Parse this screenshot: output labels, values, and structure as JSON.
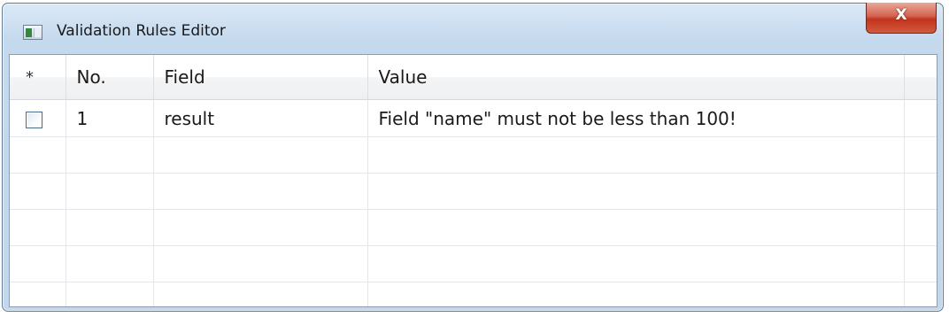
{
  "window": {
    "title": "Validation Rules Editor",
    "close_glyph": "X",
    "icon": "form-window-icon"
  },
  "grid": {
    "columns": [
      {
        "label": "*"
      },
      {
        "label": "No."
      },
      {
        "label": "Field"
      },
      {
        "label": "Value"
      },
      {
        "label": ""
      }
    ],
    "rows": [
      {
        "checked": false,
        "no": "1",
        "field": "result",
        "value": "Field \"name\" must not be less than 100!"
      }
    ],
    "empty_rows": 5
  },
  "colors": {
    "titlebar": "#c5d9ee",
    "close_button": "#c2341e",
    "grid_line": "#e3e6ea",
    "checkbox_border": "#4a6a8c"
  }
}
